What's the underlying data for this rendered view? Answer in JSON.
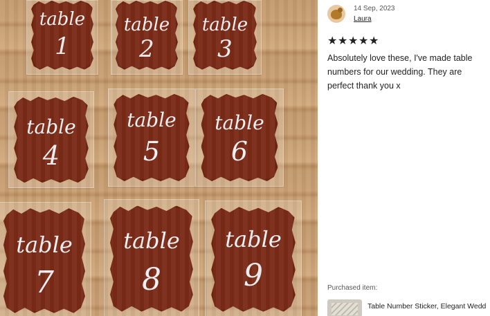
{
  "review": {
    "date": "14 Sep, 2023",
    "reviewer": "Laura",
    "rating": 5,
    "stars": "★★★★★",
    "text": "Absolutely love these, I've made table numbers for our wedding. They are perfect thank you x",
    "avatar_icon": "reviewer-avatar-icon",
    "star_icon": "star-icon"
  },
  "purchased": {
    "label": "Purchased item:",
    "title": "Table Number Sticker, Elegant Wedd"
  },
  "photo": {
    "cards": [
      {
        "word": "table",
        "number": "1"
      },
      {
        "word": "table",
        "number": "2"
      },
      {
        "word": "table",
        "number": "3"
      },
      {
        "word": "table",
        "number": "4"
      },
      {
        "word": "table",
        "number": "5"
      },
      {
        "word": "table",
        "number": "6"
      },
      {
        "word": "table",
        "number": "7"
      },
      {
        "word": "table",
        "number": "8"
      },
      {
        "word": "table",
        "number": "9"
      }
    ]
  },
  "colors": {
    "sign": "#7a2a16",
    "lettering": "#f4f1f4",
    "wood": "#c49a6e"
  }
}
